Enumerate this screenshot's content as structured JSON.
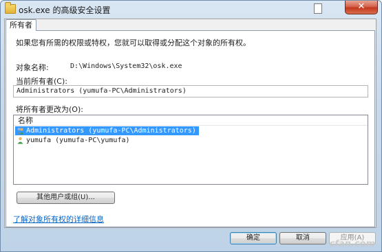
{
  "window": {
    "title": "osk.exe 的高级安全设置",
    "close_glyph": "✕"
  },
  "tab": {
    "label": "所有者"
  },
  "description": "如果您有所需的权限或特权，您就可以取得或分配这个对象的所有权。",
  "object_name": {
    "label": "对象名称:",
    "value": "D:\\Windows\\System32\\osk.exe"
  },
  "current_owner": {
    "label": "当前所有者(C):",
    "value": "Administrators (yumufa-PC\\Administrators)"
  },
  "change_owner": {
    "label": "将所有者更改为(O):",
    "column_header": "名称",
    "items": [
      {
        "name": "Administrators (yumufa-PC\\Administrators)",
        "selected": true,
        "icon": "users-group-icon"
      },
      {
        "name": "yumufa (yumufa-PC\\yumufa)",
        "selected": false,
        "icon": "user-icon"
      }
    ]
  },
  "other_users_button": "其他用户或组(U)...",
  "learn_more_link": "了解对象所有权的详细信息",
  "buttons": {
    "ok": "确定",
    "cancel": "取消",
    "apply": "应用(A)"
  },
  "watermark": "cfan.com"
}
